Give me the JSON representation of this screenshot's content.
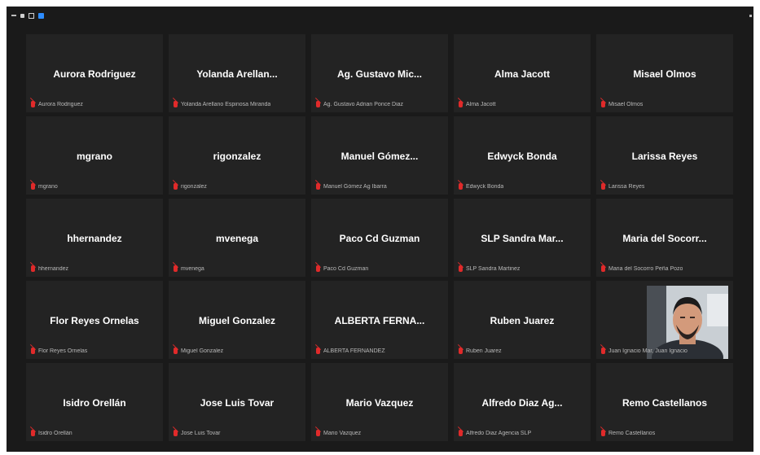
{
  "participants": [
    {
      "display_name": "Aurora Rodriguez",
      "label": "Aurora Rodriguez",
      "muted": true
    },
    {
      "display_name": "Yolanda  Arellan...",
      "label": "Yolanda Arellano Espinosa Miranda",
      "muted": true
    },
    {
      "display_name": "Ag. Gustavo Mic...",
      "label": "Ag. Gustavo Adrian Ponce Diaz",
      "muted": true
    },
    {
      "display_name": "Alma Jacott",
      "label": "Alma Jacott",
      "muted": true
    },
    {
      "display_name": "Misael Olmos",
      "label": "Misael Olmos",
      "muted": true
    },
    {
      "display_name": "mgrano",
      "label": "mgrano",
      "muted": true
    },
    {
      "display_name": "rigonzalez",
      "label": "rigonzalez",
      "muted": true
    },
    {
      "display_name": "Manuel Gómez...",
      "label": "Manuel Gómez Ag Ibarra",
      "muted": true
    },
    {
      "display_name": "Edwyck Bonda",
      "label": "Edwyck Bonda",
      "muted": true
    },
    {
      "display_name": "Larissa Reyes",
      "label": "Larissa Reyes",
      "muted": true
    },
    {
      "display_name": "hhernandez",
      "label": "hhernandez",
      "muted": true
    },
    {
      "display_name": "mvenega",
      "label": "mvenega",
      "muted": true
    },
    {
      "display_name": "Paco Cd Guzman",
      "label": "Paco Cd Guzman",
      "muted": true
    },
    {
      "display_name": "SLP Sandra Mar...",
      "label": "SLP Sandra Martinez",
      "muted": true
    },
    {
      "display_name": "Maria del Socorr...",
      "label": "Maria del Socorro Peña Pozo",
      "muted": true
    },
    {
      "display_name": "Flor Reyes Ornelas",
      "label": "Flor Reyes Ornelas",
      "muted": true
    },
    {
      "display_name": "Miguel Gonzalez",
      "label": "Miguel Gonzalez",
      "muted": true
    },
    {
      "display_name": "ALBERTA  FERNA...",
      "label": "ALBERTA FERNANDEZ",
      "muted": true
    },
    {
      "display_name": "Ruben Juarez",
      "label": "Ruben Juarez",
      "muted": true
    },
    {
      "display_name": "",
      "label": "Juan Ignacio Mar, Juan Ignacio",
      "muted": true,
      "video": true
    },
    {
      "display_name": "Isidro Orellán",
      "label": "Isidro Orellán",
      "muted": true
    },
    {
      "display_name": "Jose Luis Tovar",
      "label": "Jose Luis Tovar",
      "muted": true
    },
    {
      "display_name": "Mario Vazquez",
      "label": "Mario Vazquez",
      "muted": true
    },
    {
      "display_name": "Alfredo Diaz Ag...",
      "label": "Alfredo Diaz Agencia SLP",
      "muted": true
    },
    {
      "display_name": "Remo Castellanos",
      "label": "Remo Castellanos",
      "muted": true
    }
  ],
  "icons": {
    "muted_mic": "mic-muted-icon",
    "topbar": [
      "minimize-icon",
      "square-icon",
      "grid-view-icon",
      "security-icon"
    ]
  },
  "colors": {
    "background": "#1a1a1a",
    "tile": "#232323",
    "muted_mic": "#e02a2a",
    "name_text": "#ffffff",
    "label_text": "#b9b9b9"
  }
}
